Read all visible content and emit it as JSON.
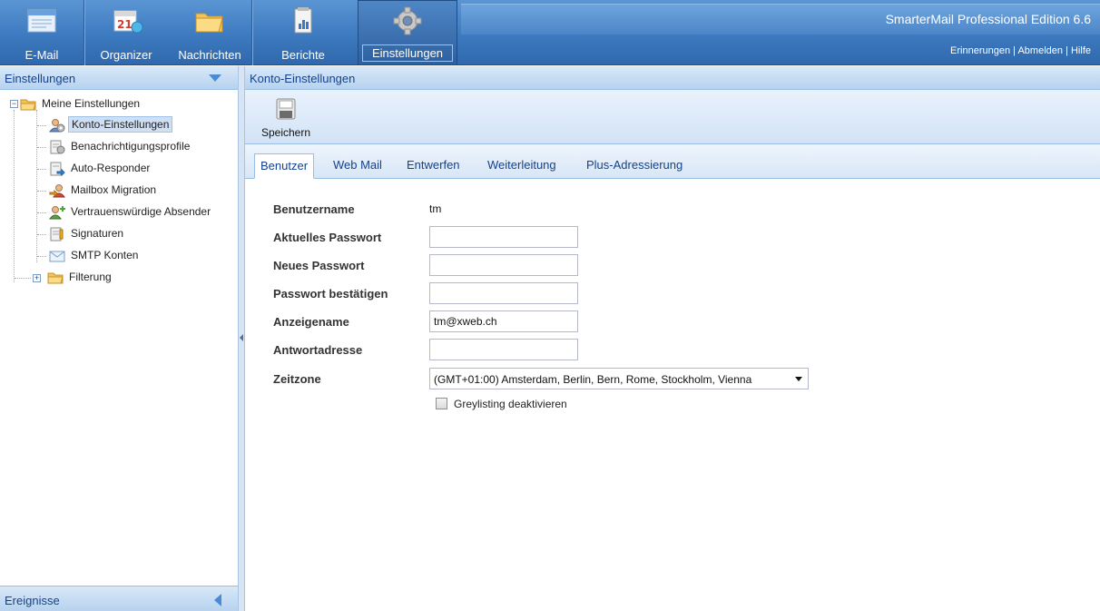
{
  "nav": {
    "email": "E-Mail",
    "organizer": "Organizer",
    "messages": "Nachrichten",
    "reports": "Berichte",
    "settings": "Einstellungen"
  },
  "brand": {
    "title": "SmarterMail Professional Edition 6.6",
    "links": [
      "Erinnerungen",
      "Abmelden",
      "Hilfe"
    ],
    "separator": "|"
  },
  "sidebar": {
    "header": "Einstellungen",
    "footer": "Ereignisse",
    "root": "Meine Einstellungen",
    "items": [
      {
        "label": "Konto-Einstellungen",
        "icon": "user-gear-icon",
        "selected": true
      },
      {
        "label": "Benachrichtigungsprofile",
        "icon": "notification-profile-icon"
      },
      {
        "label": "Auto-Responder",
        "icon": "auto-responder-icon"
      },
      {
        "label": "Mailbox Migration",
        "icon": "mailbox-migration-icon"
      },
      {
        "label": "Vertrauenswürdige Absender",
        "icon": "trusted-sender-icon"
      },
      {
        "label": "Signaturen",
        "icon": "signature-icon"
      },
      {
        "label": "SMTP Konten",
        "icon": "smtp-account-icon"
      }
    ],
    "filtering": "Filterung"
  },
  "main": {
    "header": "Konto-Einstellungen",
    "save_label": "Speichern",
    "tabs": [
      "Benutzer",
      "Web Mail",
      "Entwerfen",
      "Weiterleitung",
      "Plus-Adressierung"
    ],
    "active_tab": "Benutzer",
    "form": {
      "username_label": "Benutzername",
      "username_value": "tm",
      "current_password_label": "Aktuelles Passwort",
      "current_password_value": "",
      "new_password_label": "Neues Passwort",
      "new_password_value": "",
      "confirm_password_label": "Passwort bestätigen",
      "confirm_password_value": "",
      "display_name_label": "Anzeigename",
      "display_name_value": "tm@xweb.ch",
      "reply_address_label": "Antwortadresse",
      "reply_address_value": "",
      "timezone_label": "Zeitzone",
      "timezone_value": "(GMT+01:00) Amsterdam, Berlin, Bern, Rome, Stockholm, Vienna",
      "greylisting_label": "Greylisting deaktivieren",
      "greylisting_checked": false
    }
  },
  "colors": {
    "toolbar_blue": "#3f7cc1",
    "panel_header": "#b7d2ef",
    "accent_text": "#15428b"
  }
}
